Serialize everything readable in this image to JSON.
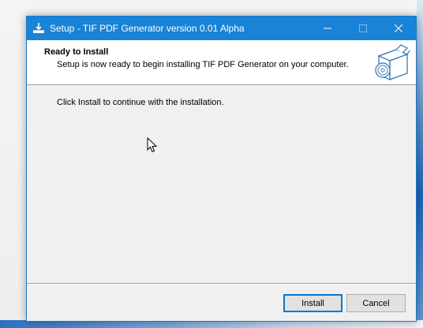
{
  "window": {
    "title": "Setup - TIF PDF Generator version 0.01 Alpha",
    "accent_color": "#1883d7",
    "icons": {
      "app": "installer-icon",
      "minimize": "minimize-icon",
      "maximize": "maximize-icon",
      "close": "close-icon"
    }
  },
  "header": {
    "title": "Ready to Install",
    "subtitle": "Setup is now ready to begin installing TIF PDF Generator on your computer.",
    "icon": "software-box-icon"
  },
  "content": {
    "instruction": "Click Install to continue with the installation."
  },
  "buttons": {
    "install": "Install",
    "cancel": "Cancel"
  },
  "pointer": "mouse-pointer-icon"
}
